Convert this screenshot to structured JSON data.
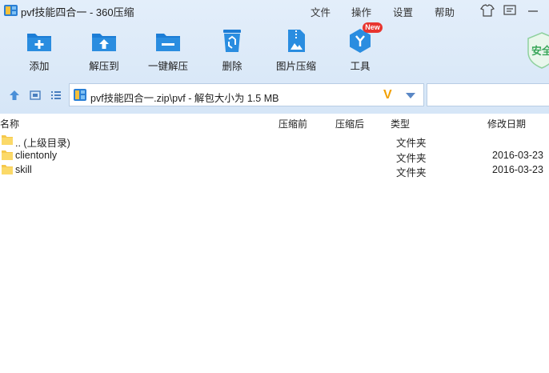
{
  "window": {
    "title": "pvf技能四合一 - 360压缩",
    "menus": [
      "文件",
      "操作",
      "设置",
      "帮助"
    ]
  },
  "toolbar": {
    "buttons": [
      {
        "label": "添加",
        "icon": "add-icon"
      },
      {
        "label": "解压到",
        "icon": "extract-to-icon"
      },
      {
        "label": "一键解压",
        "icon": "one-click-extract-icon"
      },
      {
        "label": "删除",
        "icon": "delete-icon"
      },
      {
        "label": "图片压缩",
        "icon": "image-compress-icon"
      },
      {
        "label": "工具",
        "icon": "tools-icon"
      }
    ],
    "new_badge": "New",
    "shield_label": "安全"
  },
  "address": {
    "path": "pvf技能四合一.zip\\pvf - 解包大小为 1.5 MB",
    "brand_mark": "V"
  },
  "file_list": {
    "columns": [
      "名称",
      "压缩前",
      "压缩后",
      "类型",
      "修改日期"
    ],
    "rows": [
      {
        "name": ".. (上级目录)",
        "type": "文件夹",
        "date": ""
      },
      {
        "name": "clientonly",
        "type": "文件夹",
        "date": "2016-03-23"
      },
      {
        "name": "skill",
        "type": "文件夹",
        "date": "2016-03-23"
      }
    ]
  },
  "colors": {
    "accent": "#2a8de0",
    "toolbar_bg": "#dce9f8",
    "badge": "#e8352f",
    "folder": "#f5c84c"
  }
}
